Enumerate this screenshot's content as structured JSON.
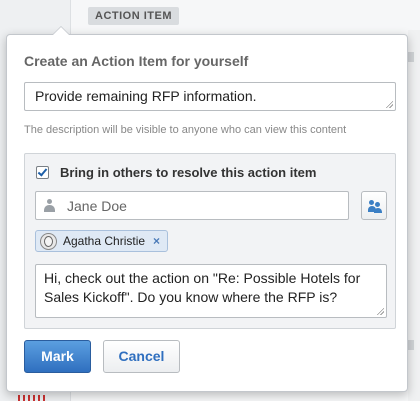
{
  "background": {
    "tab_label": "ACTION ITEM"
  },
  "popup": {
    "title": "Create an Action Item for yourself",
    "description_value": "Provide remaining RFP information.",
    "description_help": "The description will be visible to anyone who can view this content",
    "others": {
      "checked": true,
      "label": "Bring in others to resolve this action item",
      "people_placeholder": "Jane Doe",
      "selected_people": [
        {
          "name": "Agatha Christie",
          "remove_glyph": "×"
        }
      ],
      "message_value": "Hi, check out the action on \"Re: Possible Hotels for Sales Kickoff\".  Do you know where the RFP is?"
    },
    "buttons": {
      "mark_label": "Mark",
      "cancel_label": "Cancel"
    }
  },
  "colors": {
    "accent": "#2f6fbf",
    "chip_bg": "#dfe9f5"
  },
  "icons": [
    "checkbox-check-icon",
    "person-icon",
    "people-picker-icon",
    "avatar",
    "remove-icon"
  ]
}
